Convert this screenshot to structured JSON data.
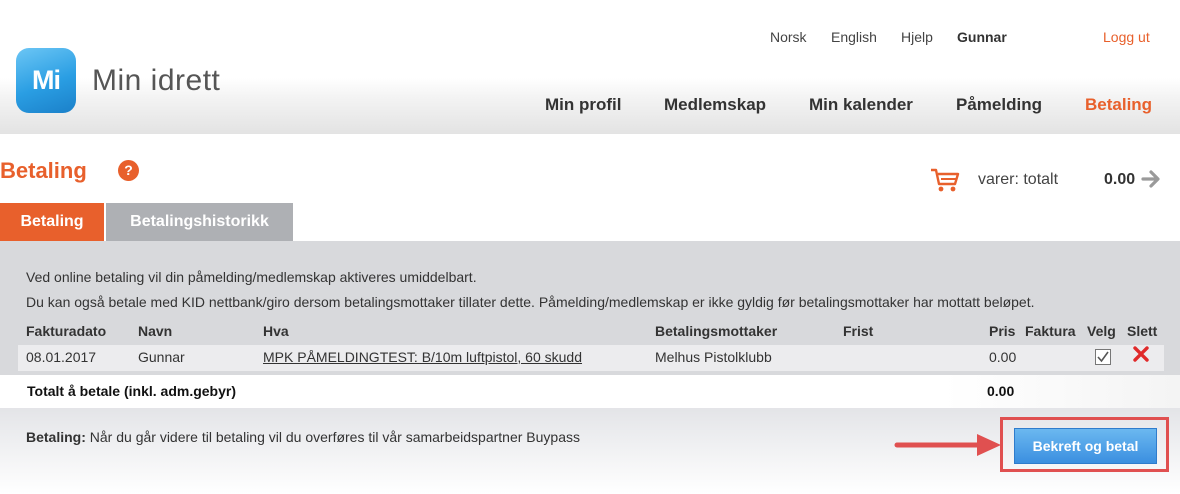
{
  "toplinks": {
    "lang_no": "Norsk",
    "lang_en": "English",
    "help": "Hjelp",
    "user": "Gunnar",
    "logout": "Logg ut"
  },
  "logo": {
    "mark": "Mi",
    "text": "Min idrett",
    "color": "#2a9ee3"
  },
  "nav": {
    "profile": "Min profil",
    "membership": "Medlemskap",
    "calendar": "Min kalender",
    "registration": "Påmelding",
    "payment": "Betaling"
  },
  "page": {
    "title": "Betaling",
    "help_icon": "?"
  },
  "cart": {
    "label": "varer: totalt",
    "total": "0.00"
  },
  "tabs": {
    "payment": "Betaling",
    "history": "Betalingshistorikk"
  },
  "info": {
    "line1": "Ved online betaling vil din påmelding/medlemskap aktiveres umiddelbart.",
    "line2": "Du kan også betale med KID nettbank/giro dersom betalingsmottaker tillater dette. Påmelding/medlemskap er ikke gyldig før betalingsmottaker har mottatt beløpet."
  },
  "table": {
    "headers": {
      "date": "Fakturadato",
      "name": "Navn",
      "what": "Hva",
      "recipient": "Betalingsmottaker",
      "deadline": "Frist",
      "price": "Pris",
      "invoice": "Faktura",
      "select": "Velg",
      "delete": "Slett"
    },
    "rows": [
      {
        "date": "08.01.2017",
        "name": "Gunnar",
        "what": "MPK PÅMELDINGTEST: B/10m luftpistol, 60 skudd",
        "recipient": "Melhus Pistolklubb",
        "deadline": "",
        "price": "0.00",
        "selected": true
      }
    ]
  },
  "total": {
    "label": "Totalt å betale (inkl. adm.gebyr)",
    "value": "0.00"
  },
  "footer": {
    "label": "Betaling:",
    "text": "Når du går videre til betaling vil du overføres til vår samarbeidspartner Buypass"
  },
  "confirm_button": "Bekreft og betal",
  "colors": {
    "accent": "#e8602c",
    "tab_inactive": "#aeb0b4",
    "button": "#3b8fe0",
    "highlight": "#e05050"
  }
}
